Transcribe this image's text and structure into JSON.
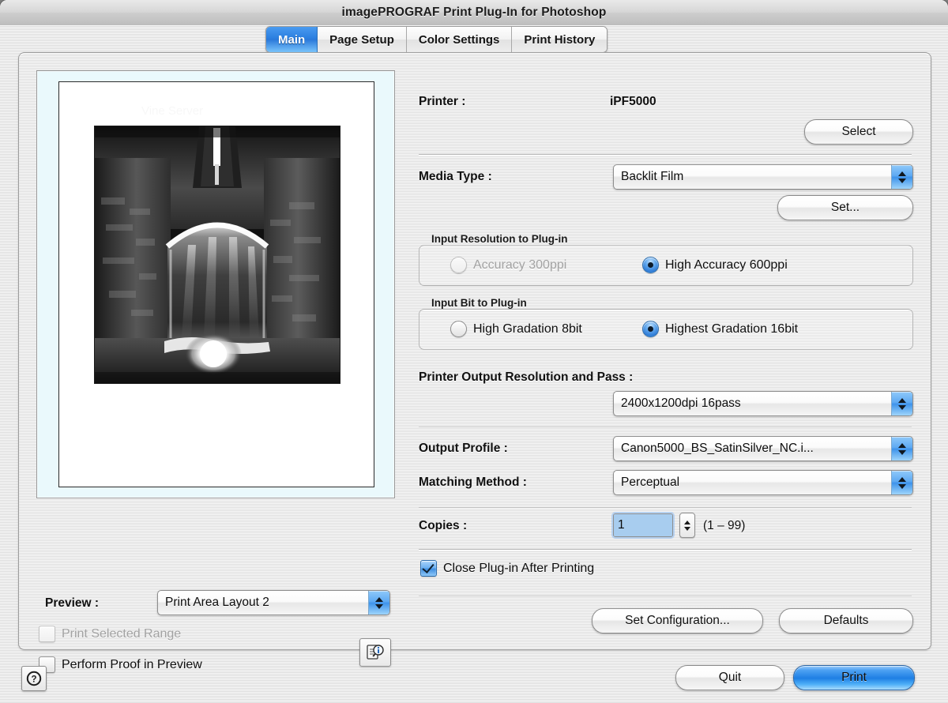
{
  "window": {
    "title": "imagePROGRAF Print Plug-In for Photoshop"
  },
  "tabs": [
    {
      "label": "Main",
      "active": true
    },
    {
      "label": "Page Setup",
      "active": false
    },
    {
      "label": "Color Settings",
      "active": false
    },
    {
      "label": "Print History",
      "active": false
    }
  ],
  "preview": {
    "label": "Preview :",
    "layout_value": "Print Area Layout 2",
    "watermark_top": "Vine Server",
    "print_selected_range": {
      "label": "Print Selected Range",
      "checked": false,
      "enabled": false
    },
    "perform_proof": {
      "label": "Perform Proof in Preview",
      "checked": false,
      "enabled": true
    },
    "info_icon": "document-info-icon"
  },
  "settings": {
    "printer_label": "Printer :",
    "printer_value": "iPF5000",
    "select_button": "Select",
    "media_type_label": "Media Type :",
    "media_type_value": "Backlit Film",
    "set_button": "Set...",
    "input_resolution_group": {
      "title": "Input Resolution to Plug-in",
      "options": [
        {
          "label": "Accuracy 300ppi",
          "selected": false,
          "enabled": false
        },
        {
          "label": "High Accuracy 600ppi",
          "selected": true,
          "enabled": true
        }
      ]
    },
    "input_bit_group": {
      "title": "Input Bit to Plug-in",
      "options": [
        {
          "label": "High Gradation 8bit",
          "selected": false,
          "enabled": true
        },
        {
          "label": "Highest Gradation 16bit",
          "selected": true,
          "enabled": true
        }
      ]
    },
    "output_res_label": "Printer Output Resolution and Pass :",
    "output_res_value": "2400x1200dpi 16pass",
    "output_profile_label": "Output Profile :",
    "output_profile_value": "Canon5000_BS_SatinSilver_NC.i...",
    "matching_method_label": "Matching Method :",
    "matching_method_value": "Perceptual",
    "copies_label": "Copies :",
    "copies_value": "1",
    "copies_range": "(1 – 99)",
    "close_plugin": {
      "label": "Close Plug-in After Printing",
      "checked": true
    },
    "set_configuration_button": "Set Configuration...",
    "defaults_button": "Defaults"
  },
  "footer": {
    "help_icon": "help-question-icon",
    "quit_button": "Quit",
    "print_button": "Print"
  },
  "colors": {
    "accent_blue": "#2b7fe0",
    "default_button_blue": "#1f7fe4",
    "preview_backdrop": "#eaf9fc",
    "window_body": "#ececec"
  }
}
